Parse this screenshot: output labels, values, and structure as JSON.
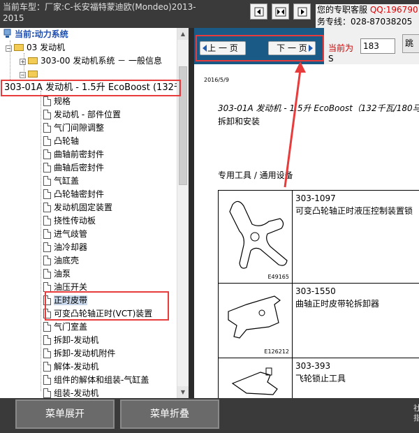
{
  "header": {
    "vehicle_line1": "当前车型：厂家:C-长安福特蒙迪欧(Mondeo)2013-",
    "vehicle_line2": "2015",
    "service_line1_prefix": "您的专职客服",
    "service_qq": "QQ:196790",
    "service_line2": "务专线：028-87038205"
  },
  "nav_icons": [
    "prev-frame-icon",
    "split-frame-icon",
    "next-frame-icon"
  ],
  "tree": {
    "current_system": "当前:动力系统",
    "folder_engine": "03 发动机",
    "folder_general": "303-00 发动机系统 － 一般信息",
    "selected_node": "303-01A 发动机 - 1.5升 EcoBoost (132千",
    "items": [
      "规格",
      "发动机 - 部件位置",
      "气门间隙调整",
      "凸轮轴",
      "曲轴前密封件",
      "曲轴后密封件",
      "气缸盖",
      "凸轮轴密封件",
      "发动机固定装置",
      "挠性传动板",
      "进气歧管",
      "油冷却器",
      "油底壳",
      "油泵",
      "油压开关",
      "正时皮带",
      "可变凸轮轴正时(VCT)装置",
      "气门室盖",
      "拆卸-发动机",
      "拆卸-发动机附件",
      "解体-发动机",
      "组件的解体和组装-气缸盖",
      "组装-发动机"
    ]
  },
  "pager": {
    "prev_label": "上 一 页",
    "next_label": "下 一 页",
    "current_label": "当前为",
    "current_value": "183",
    "jump_label": "跳",
    "current_suffix": "S"
  },
  "document": {
    "date": "2016/5/9",
    "title": "303-01A 发动机 - 1.5升 EcoBoost（132千瓦/180马",
    "subtitle": "拆卸和安装",
    "tools_heading": "专用工具 / 通用设备",
    "tools": [
      {
        "code": "303-1097",
        "desc": "可变凸轮轴正时液压控制装置锁",
        "image_id": "E49165"
      },
      {
        "code": "303-1550",
        "desc": "曲轴正时皮带轮拆卸器",
        "image_id": "E126212"
      },
      {
        "code": "303-393",
        "desc": "飞轮锁止工具",
        "image_id": ""
      }
    ]
  },
  "footer": {
    "expand_label": "菜单展开",
    "collapse_label": "菜单折叠",
    "right_text": "社 指"
  },
  "colors": {
    "highlight": "#e83c3c",
    "pager_bg": "#1a5a86",
    "qq": "#e00000"
  }
}
